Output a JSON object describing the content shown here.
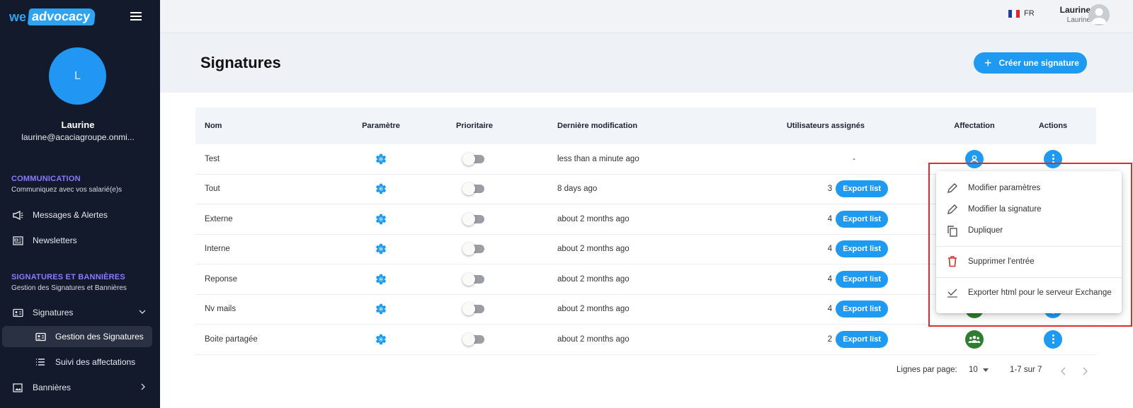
{
  "app": {
    "logo_we": "we",
    "logo_adv": "advocacy"
  },
  "sidebar": {
    "avatar_letter": "L",
    "user_name": "Laurine",
    "user_email": "laurine@acaciagroupe.onmi...",
    "sections": [
      {
        "title": "COMMUNICATION",
        "subtitle": "Communiquez avec vos salarié(e)s"
      },
      {
        "title": "SIGNATURES ET BANNIÈRES",
        "subtitle": "Gestion des Signatures et Bannières"
      }
    ],
    "items": {
      "messages": "Messages & Alertes",
      "newsletters": "Newsletters",
      "signatures": "Signatures",
      "gestion": "Gestion des Signatures",
      "suivi": "Suivi des affectations",
      "bannieres": "Bannières"
    }
  },
  "topbar": {
    "lang": "FR",
    "user_name": "Laurine",
    "user_sub": "Laurine",
    "flag_colors": [
      "#1f3ea3",
      "#ffffff",
      "#e0262f"
    ]
  },
  "header": {
    "title": "Signatures",
    "create_label": "Créer une signature"
  },
  "table": {
    "columns": {
      "nom": "Nom",
      "parametre": "Paramètre",
      "prioritaire": "Prioritaire",
      "modif": "Dernière modification",
      "users": "Utilisateurs assignés",
      "affect": "Affectation",
      "actions": "Actions"
    },
    "export_label": "Export list",
    "rows": [
      {
        "nom": "Test",
        "date": "less than a minute ago",
        "users": "-",
        "affect_icon": "person-icon"
      },
      {
        "nom": "Tout",
        "date": "8 days ago",
        "users": "3",
        "affect_icon": "group-icon"
      },
      {
        "nom": "Externe",
        "date": "about 2 months ago",
        "users": "4",
        "affect_icon": "group-icon"
      },
      {
        "nom": "Interne",
        "date": "about 2 months ago",
        "users": "4",
        "affect_icon": "group-icon"
      },
      {
        "nom": "Reponse",
        "date": "about 2 months ago",
        "users": "4",
        "affect_icon": "group-icon"
      },
      {
        "nom": "Nv mails",
        "date": "about 2 months ago",
        "users": "4",
        "affect_icon": "group-icon"
      },
      {
        "nom": "Boite partagée",
        "date": "about 2 months ago",
        "users": "2",
        "affect_icon": "group-icon"
      }
    ]
  },
  "pagination": {
    "rows_label": "Lignes par page:",
    "rows_value": "10",
    "range": "1-7 sur 7"
  },
  "context_menu": {
    "items": [
      {
        "label": "Modifier paramètres",
        "icon": "pencil-icon"
      },
      {
        "label": "Modifier la signature",
        "icon": "pencil-icon"
      },
      {
        "label": "Dupliquer",
        "icon": "copy-icon"
      },
      {
        "label": "Supprimer l'entrée",
        "icon": "trash-icon"
      },
      {
        "label": "Exporter html pour le serveur Exchange",
        "icon": "check-icon"
      }
    ]
  },
  "colors": {
    "accent": "#1e9af2",
    "sidebar": "#131a2b",
    "section": "#8a7bff",
    "danger": "#d32f2f",
    "green": "#2e7d32",
    "highlight": "#e22a2a"
  }
}
